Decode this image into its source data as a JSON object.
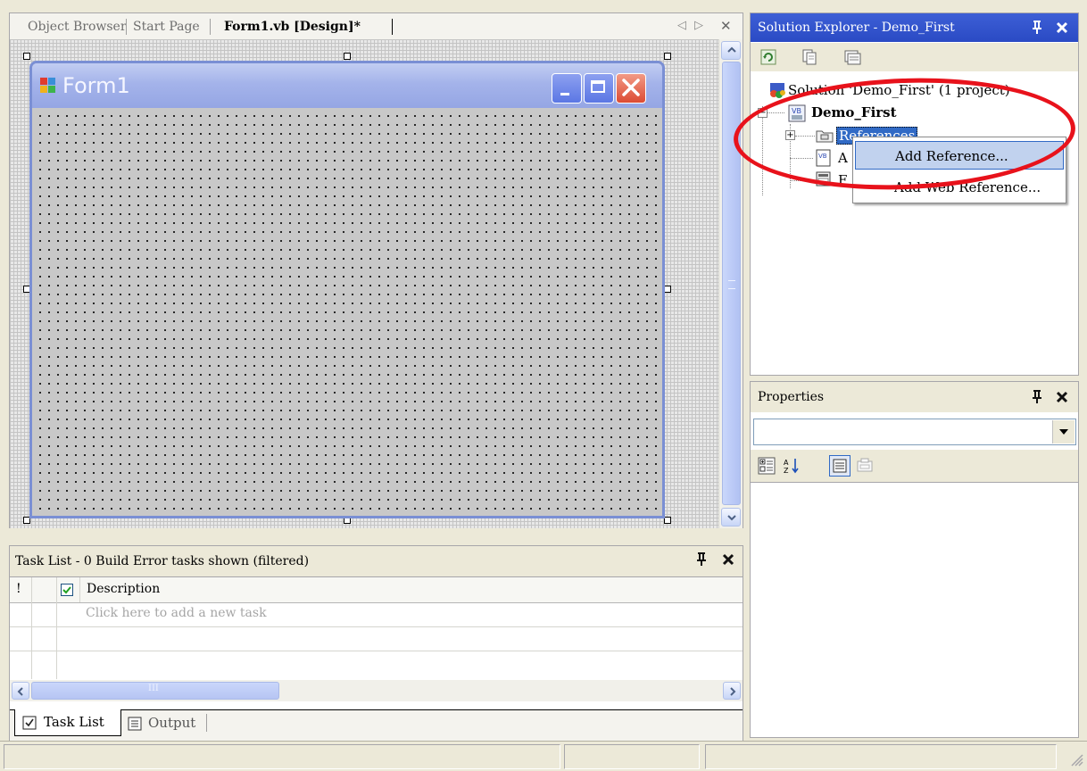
{
  "tabs": {
    "items": [
      {
        "label": "Object Browser"
      },
      {
        "label": "Start Page"
      },
      {
        "label": "Form1.vb [Design]*"
      }
    ],
    "nav_left": "◁",
    "nav_right": "▷",
    "close": "✕"
  },
  "form": {
    "title": "Form1",
    "caption_buttons": [
      "minimize-icon",
      "maximize-icon",
      "close-icon"
    ],
    "colors": {
      "titlebar": "#a4b3ea",
      "close_button": "#e2654f",
      "border": "#7a8fd4"
    }
  },
  "task_list": {
    "title": "Task List - 0 Build Error tasks shown (filtered)",
    "columns": {
      "priority": "!",
      "description": "Description"
    },
    "new_task_placeholder": "Click here to add a new task",
    "scroll_grip": "III",
    "bottom_tabs": [
      {
        "label": "Task List",
        "icon": "checkbox-icon"
      },
      {
        "label": "Output",
        "icon": "output-icon"
      }
    ]
  },
  "solution_explorer": {
    "title": "Solution Explorer - Demo_First",
    "tree": {
      "solution": "Solution 'Demo_First' (1 project)",
      "project": "Demo_First",
      "references": "References",
      "assembly_partial": "A",
      "form_partial": "F"
    },
    "context_menu": {
      "add_reference": "Add Reference...",
      "add_web_reference": "Add Web Reference..."
    },
    "colors": {
      "caption": "#2a4ac4",
      "highlight_ring": "#e8121b"
    }
  },
  "properties": {
    "title": "Properties",
    "object_combo_value": ""
  },
  "panel_icons": {
    "pin": "pin-icon",
    "close": "close-icon"
  }
}
